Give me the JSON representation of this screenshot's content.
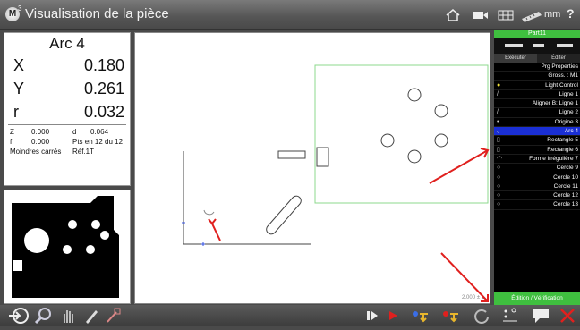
{
  "window": {
    "title": "Visualisation de la pièce",
    "logo": "M",
    "logo_sup": "3",
    "unit": "mm",
    "help": "?"
  },
  "readout": {
    "feature": "Arc 4",
    "rows": [
      {
        "label": "X",
        "value": "0.180"
      },
      {
        "label": "Y",
        "value": "0.261"
      },
      {
        "label": "r",
        "value": "0.032"
      }
    ],
    "details": {
      "z_label": "Z",
      "z_value": "0.000",
      "d_label": "d",
      "d_value": "0.064",
      "f_label": "f",
      "f_value": "0.000",
      "pts": "Pts en 12 du 12",
      "method": "Moindres carrés",
      "ref": "Réf.1T"
    }
  },
  "canvas": {
    "scale_text": "2.000 ± 1"
  },
  "right_panel": {
    "part_name": "Part11",
    "tabs": [
      "Exécuter",
      "Éditer"
    ],
    "items": [
      {
        "icon": "",
        "label": "Prg Properties"
      },
      {
        "icon": "",
        "label": "Gross. : M1"
      },
      {
        "icon": "bulb-icon",
        "label": "Light Control"
      },
      {
        "icon": "line-icon",
        "label": "Ligne 1"
      },
      {
        "icon": "",
        "label": "Aligner B: Ligne 1"
      },
      {
        "icon": "line-icon",
        "label": "Ligne 2"
      },
      {
        "icon": "point-icon",
        "label": "Origine 3"
      },
      {
        "icon": "arc-icon",
        "label": "Arc 4"
      },
      {
        "icon": "rectangle-icon",
        "label": "Rectangle 5"
      },
      {
        "icon": "rectangle-icon",
        "label": "Rectangle 6"
      },
      {
        "icon": "freeform-icon",
        "label": "Forme irrégulière 7"
      },
      {
        "icon": "circle-icon",
        "label": "Cercle 9"
      },
      {
        "icon": "circle-icon",
        "label": "Cercle 10"
      },
      {
        "icon": "circle-icon",
        "label": "Cercle 11"
      },
      {
        "icon": "circle-icon",
        "label": "Cercle 12"
      },
      {
        "icon": "circle-icon",
        "label": "Cercle 13"
      }
    ],
    "selected_index": 7,
    "edit_button": "Édition / Vérification"
  },
  "colors": {
    "accent_green": "#3fbf3f",
    "selection_blue": "#1a2fd4",
    "annotation_red": "#e0201e"
  }
}
